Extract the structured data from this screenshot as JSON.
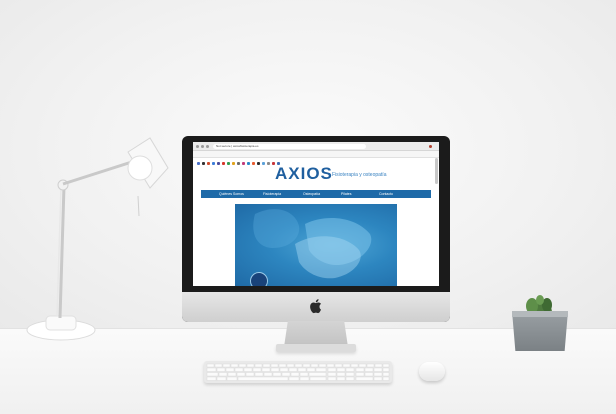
{
  "browser": {
    "url": "Not secure | axiosfisioterapia.es"
  },
  "website": {
    "logo_text": "AXIOS",
    "tagline": "Fisioterapia y osteopatía",
    "nav_items": [
      "Quiénes Somos",
      "Fisioterapia",
      "Osteopatía",
      "Pilates",
      "Contacto"
    ],
    "colors": {
      "brand_blue": "#1e6aa8",
      "logo_blue": "#1f5f9f",
      "hero_blue": "#2d86c0"
    }
  },
  "scene": {
    "objects": [
      "desk-lamp",
      "imac",
      "keyboard",
      "mouse",
      "cactus-pot"
    ],
    "colors": {
      "wall": "#f3f3f3",
      "desk": "#f5f5f5"
    }
  }
}
